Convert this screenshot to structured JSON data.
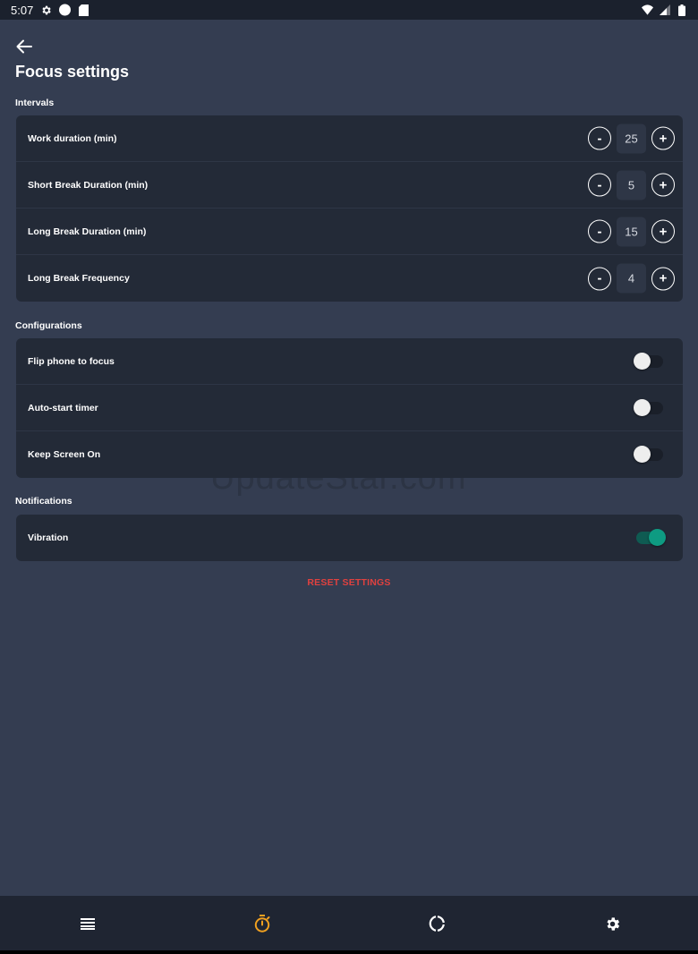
{
  "status_bar": {
    "time": "5:07",
    "left_icons": [
      "gear-icon",
      "circle-icon",
      "sd-card-icon"
    ],
    "right_icons": [
      "wifi-icon",
      "signal-icon",
      "battery-icon"
    ]
  },
  "header": {
    "title": "Focus settings"
  },
  "intervals": {
    "section_label": "Intervals",
    "items": [
      {
        "label": "Work duration (min)",
        "value": "25",
        "minus": "-",
        "plus": "+"
      },
      {
        "label": "Short Break Duration (min)",
        "value": "5",
        "minus": "-",
        "plus": "+"
      },
      {
        "label": "Long Break Duration (min)",
        "value": "15",
        "minus": "-",
        "plus": "+"
      },
      {
        "label": "Long Break Frequency",
        "value": "4",
        "minus": "-",
        "plus": "+"
      }
    ]
  },
  "configurations": {
    "section_label": "Configurations",
    "items": [
      {
        "label": "Flip phone to focus",
        "enabled": false
      },
      {
        "label": "Auto-start timer",
        "enabled": false
      },
      {
        "label": "Keep Screen On",
        "enabled": false
      }
    ]
  },
  "notifications": {
    "section_label": "Notifications",
    "items": [
      {
        "label": "Vibration",
        "enabled": true
      }
    ]
  },
  "reset_label": "RESET SETTINGS",
  "watermark": "UpdateStar.com",
  "bottom_nav": {
    "items": [
      "list-icon",
      "timer-icon",
      "stats-icon",
      "settings-icon"
    ],
    "active": "timer-icon"
  },
  "colors": {
    "background": "#343d51",
    "card": "#232a37",
    "accent_active_nav": "#f0a020",
    "toggle_on": "#0e9b82",
    "reset": "#e0413f"
  }
}
